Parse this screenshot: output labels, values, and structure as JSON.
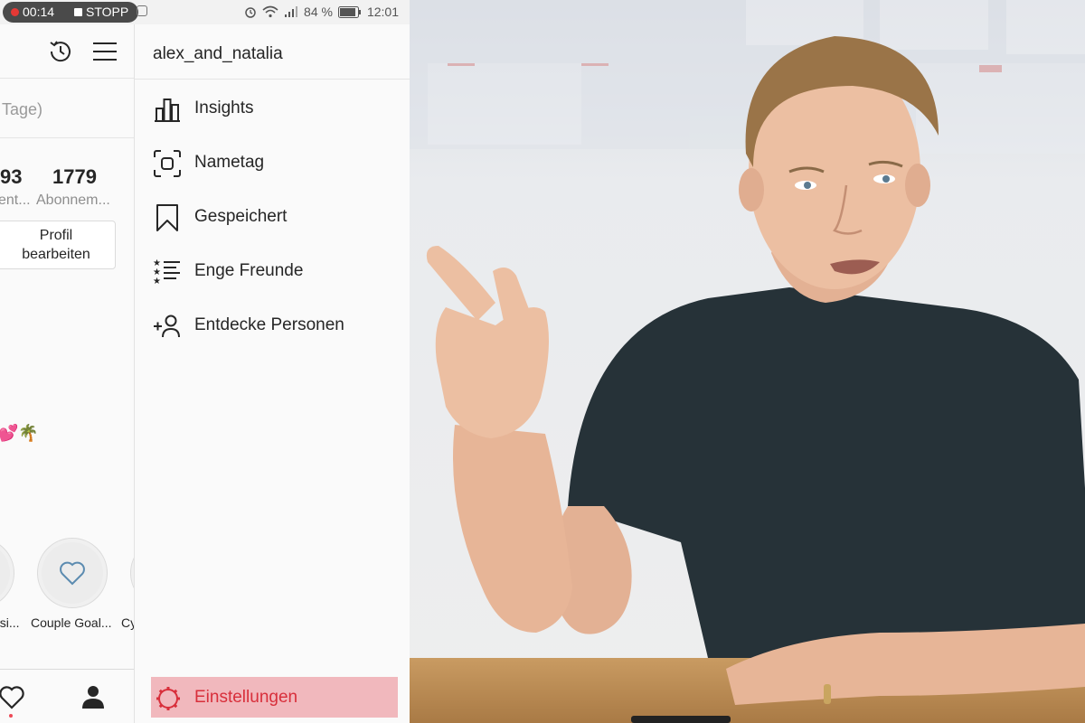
{
  "statusbar": {
    "record_time": "00:14",
    "stop_label": "STOPP",
    "battery": "84 %",
    "clock": "12:01"
  },
  "profile": {
    "tage_text": "Tage)",
    "stats": [
      {
        "number": "93",
        "label": "ent..."
      },
      {
        "number": "1779",
        "label": "Abonnem..."
      }
    ],
    "edit_line1": "Profil",
    "edit_line2": "bearbeiten",
    "emoji": "💕🌴",
    "highlights": [
      {
        "label": "usi..."
      },
      {
        "label": "Couple Goal..."
      },
      {
        "label": "Cy"
      }
    ]
  },
  "drawer": {
    "username": "alex_and_natalia",
    "items": [
      {
        "label": "Insights",
        "icon": "bar-chart-icon"
      },
      {
        "label": "Nametag",
        "icon": "nametag-icon"
      },
      {
        "label": "Gespeichert",
        "icon": "bookmark-icon"
      },
      {
        "label": "Enge Freunde",
        "icon": "close-friends-list-icon"
      },
      {
        "label": "Entdecke Personen",
        "icon": "add-person-icon"
      }
    ],
    "settings_label": "Einstellungen"
  },
  "colors": {
    "settings_highlight": "#f1b8bd",
    "settings_text": "#d82f3b",
    "record_dot": "#e53935"
  }
}
